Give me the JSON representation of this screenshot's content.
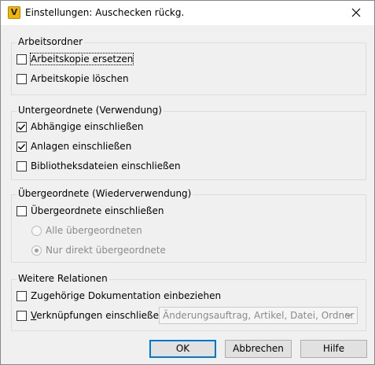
{
  "window": {
    "title": "Einstellungen: Auschecken rückg.",
    "app_icon_letter": "V"
  },
  "groups": {
    "arbeitsordner": {
      "legend": "Arbeitsordner",
      "options": [
        {
          "label": "Arbeitskopie ersetzen",
          "checked": false
        },
        {
          "label": "Arbeitskopie löschen",
          "checked": false
        }
      ]
    },
    "untergeordnete": {
      "legend": "Untergeordnete (Verwendung)",
      "options": [
        {
          "label": "Abhängige einschließen",
          "checked": true
        },
        {
          "label": "Anlagen einschließen",
          "checked": true
        },
        {
          "label": "Bibliotheksdateien einschließen",
          "checked": false
        }
      ]
    },
    "uebergeordnete": {
      "legend": "Übergeordnete (Wiederverwendung)",
      "checkbox": {
        "label": "Übergeordnete einschließen",
        "checked": false
      },
      "radios": [
        {
          "label": "Alle übergeordneten",
          "selected": false
        },
        {
          "label": "Nur direkt übergeordnete",
          "selected": true
        }
      ]
    },
    "weitere": {
      "legend": "Weitere Relationen",
      "options": [
        {
          "label": "Zugehörige Dokumentation einbeziehen",
          "checked": false
        },
        {
          "label_prefix": "V",
          "label_rest": "erknüpfungen einschließen",
          "checked": false
        }
      ],
      "combo_value": "Änderungsauftrag, Artikel, Datei, Ordner"
    }
  },
  "buttons": {
    "ok": "OK",
    "cancel": "Abbrechen",
    "help": "Hilfe"
  }
}
